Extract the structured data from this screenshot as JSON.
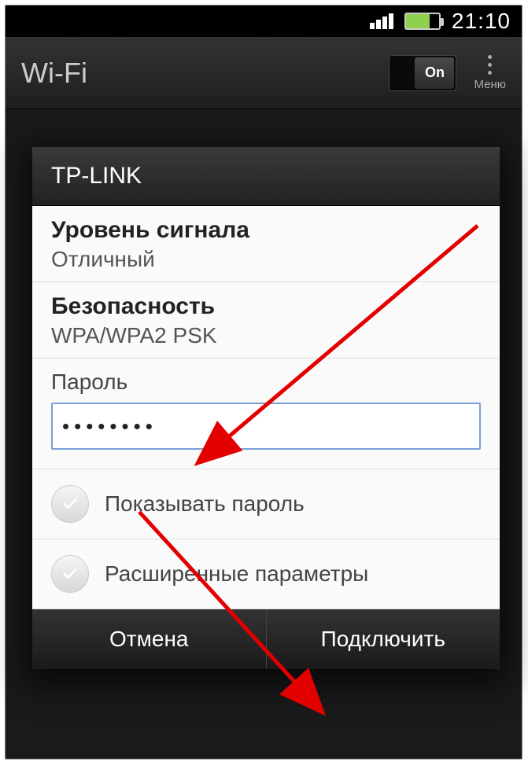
{
  "status_bar": {
    "time": "21:10"
  },
  "header": {
    "title": "Wi-Fi",
    "toggle_label": "On",
    "menu_label": "Меню"
  },
  "dialog": {
    "title": "TP-LINK",
    "signal_label": "Уровень сигнала",
    "signal_value": "Отличный",
    "security_label": "Безопасность",
    "security_value": "WPA/WPA2 PSK",
    "password_label": "Пароль",
    "password_value": "••••••••",
    "show_password_label": "Показывать пароль",
    "advanced_label": "Расширенные параметры",
    "cancel_label": "Отмена",
    "connect_label": "Подключить"
  }
}
